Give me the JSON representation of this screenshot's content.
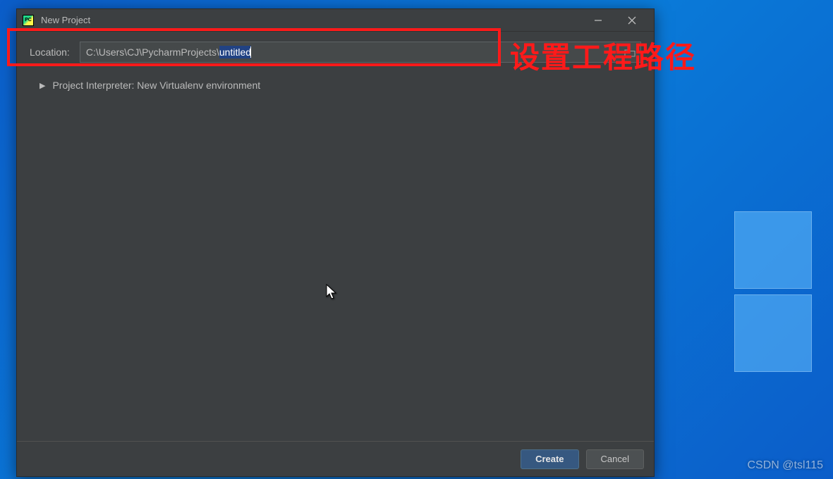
{
  "window": {
    "title": "New Project",
    "app_icon_label": "PC"
  },
  "location_row": {
    "label": "Location:",
    "path_prefix": "C:\\Users\\CJ\\PycharmProjects\\",
    "path_selected": "untitled"
  },
  "interpreter_row": {
    "label": "Project Interpreter: New Virtualenv environment"
  },
  "footer": {
    "create_label": "Create",
    "cancel_label": "Cancel"
  },
  "annotation": {
    "text": "设置工程路径"
  },
  "watermark": "CSDN @tsl115"
}
